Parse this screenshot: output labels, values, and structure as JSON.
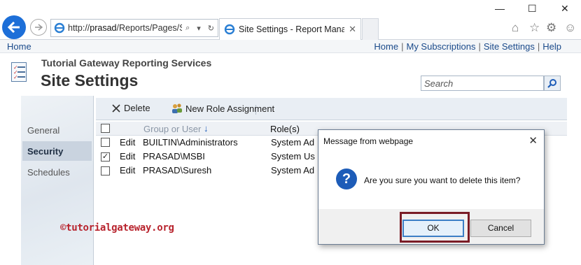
{
  "browser": {
    "url_prefix": "http://",
    "url_host": "prasad",
    "url_path": "/Reports/Pages/S",
    "tab_title": "Site Settings - Report Mana...",
    "tab_close": "✕",
    "window_controls": {
      "minimize": "—",
      "maximize": "☐",
      "close": "✕"
    },
    "icons": [
      "home-icon",
      "star-icon",
      "gear-icon",
      "smiley-icon"
    ]
  },
  "topbar": {
    "home": "Home",
    "links": [
      "Home",
      "My Subscriptions",
      "Site Settings",
      "Help"
    ],
    "separator": "|"
  },
  "header": {
    "org": "Tutorial Gateway Reporting Services",
    "title": "Site Settings",
    "search_placeholder": "Search"
  },
  "sidebar": {
    "items": [
      {
        "label": "General",
        "selected": false
      },
      {
        "label": "Security",
        "selected": true
      },
      {
        "label": "Schedules",
        "selected": false
      }
    ]
  },
  "toolbar": {
    "delete_label": "Delete",
    "new_role_label": "New Role Assignment"
  },
  "table": {
    "columns": [
      "Group or User",
      "Role(s)"
    ],
    "sort_indicator": "↓",
    "rows": [
      {
        "checked": false,
        "edit": "Edit",
        "user": "BUILTIN\\Administrators",
        "role": "System Ad"
      },
      {
        "checked": true,
        "edit": "Edit",
        "user": "PRASAD\\MSBI",
        "role": "System Us"
      },
      {
        "checked": false,
        "edit": "Edit",
        "user": "PRASAD\\Suresh",
        "role": "System Ad"
      }
    ]
  },
  "watermark": "©tutorialgateway.org",
  "dialog": {
    "title": "Message from webpage",
    "message": "Are you sure you want to delete this item?",
    "ok": "OK",
    "cancel": "Cancel",
    "icon": "question-icon",
    "close": "✕"
  },
  "colors": {
    "accent": "#1d6fd8",
    "link": "#1a4a8a",
    "highlight_border": "#7a1c26",
    "watermark": "#b8242e"
  }
}
